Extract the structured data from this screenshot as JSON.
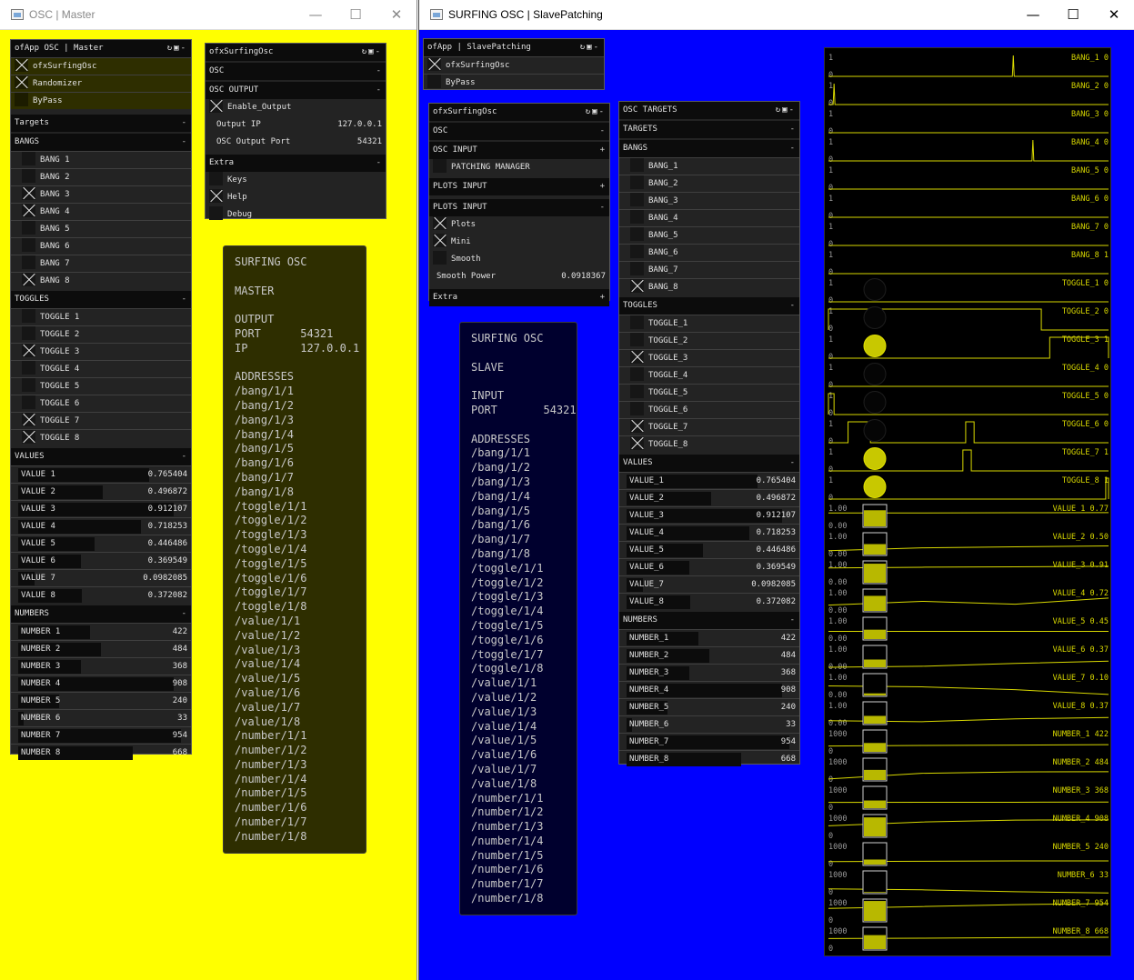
{
  "master": {
    "title": "OSC | Master",
    "bg": "#ffff00",
    "gui": {
      "title": "ofApp OSC | Master",
      "toggles": [
        {
          "label": "ofxSurfingOsc",
          "on": true
        },
        {
          "label": "Randomizer",
          "on": true
        },
        {
          "label": "ByPass",
          "on": false
        }
      ],
      "targets_label": "Targets",
      "bangs_label": "BANGS",
      "bangs": [
        {
          "label": "BANG 1",
          "on": false
        },
        {
          "label": "BANG 2",
          "on": false
        },
        {
          "label": "BANG 3",
          "on": true
        },
        {
          "label": "BANG 4",
          "on": true
        },
        {
          "label": "BANG 5",
          "on": false
        },
        {
          "label": "BANG 6",
          "on": false
        },
        {
          "label": "BANG 7",
          "on": false
        },
        {
          "label": "BANG 8",
          "on": true
        }
      ],
      "toggles_label": "TOGGLES",
      "toggle_items": [
        {
          "label": "TOGGLE 1",
          "on": false
        },
        {
          "label": "TOGGLE 2",
          "on": false
        },
        {
          "label": "TOGGLE 3",
          "on": true
        },
        {
          "label": "TOGGLE 4",
          "on": false
        },
        {
          "label": "TOGGLE 5",
          "on": false
        },
        {
          "label": "TOGGLE 6",
          "on": false
        },
        {
          "label": "TOGGLE 7",
          "on": true
        },
        {
          "label": "TOGGLE 8",
          "on": true
        }
      ],
      "values_label": "VALUES",
      "values": [
        {
          "label": "VALUE 1",
          "value": "0.765404",
          "fill": 0.765404
        },
        {
          "label": "VALUE 2",
          "value": "0.496872",
          "fill": 0.496872
        },
        {
          "label": "VALUE 3",
          "value": "0.912107",
          "fill": 0.912107
        },
        {
          "label": "VALUE 4",
          "value": "0.718253",
          "fill": 0.718253
        },
        {
          "label": "VALUE 5",
          "value": "0.446486",
          "fill": 0.446486
        },
        {
          "label": "VALUE 6",
          "value": "0.369549",
          "fill": 0.369549
        },
        {
          "label": "VALUE 7",
          "value": "0.0982085",
          "fill": 0.0982085
        },
        {
          "label": "VALUE 8",
          "value": "0.372082",
          "fill": 0.372082
        }
      ],
      "numbers_label": "NUMBERS",
      "numbers": [
        {
          "label": "NUMBER 1",
          "value": "422",
          "fill": 0.422
        },
        {
          "label": "NUMBER 2",
          "value": "484",
          "fill": 0.484
        },
        {
          "label": "NUMBER 3",
          "value": "368",
          "fill": 0.368
        },
        {
          "label": "NUMBER 4",
          "value": "908",
          "fill": 0.908
        },
        {
          "label": "NUMBER 5",
          "value": "240",
          "fill": 0.24
        },
        {
          "label": "NUMBER 6",
          "value": "33",
          "fill": 0.033
        },
        {
          "label": "NUMBER 7",
          "value": "954",
          "fill": 0.954
        },
        {
          "label": "NUMBER 8",
          "value": "668",
          "fill": 0.668
        }
      ]
    },
    "osc_gui": {
      "title": "ofxSurfingOsc",
      "osc_label": "OSC",
      "osc_output_label": "OSC OUTPUT",
      "enable_output": "Enable_Output",
      "output_ip_label": "Output IP",
      "output_ip": "127.0.0.1",
      "output_port_label": "OSC Output Port",
      "output_port": "54321",
      "extra_label": "Extra",
      "keys": "Keys",
      "help": "Help",
      "debug": "Debug"
    },
    "info": "SURFING OSC\n\nMASTER\n\nOUTPUT\nPORT      54321\nIP        127.0.0.1\n\nADDRESSES\n/bang/1/1\n/bang/1/2\n/bang/1/3\n/bang/1/4\n/bang/1/5\n/bang/1/6\n/bang/1/7\n/bang/1/8\n/toggle/1/1\n/toggle/1/2\n/toggle/1/3\n/toggle/1/4\n/toggle/1/5\n/toggle/1/6\n/toggle/1/7\n/toggle/1/8\n/value/1/1\n/value/1/2\n/value/1/3\n/value/1/4\n/value/1/5\n/value/1/6\n/value/1/7\n/value/1/8\n/number/1/1\n/number/1/2\n/number/1/3\n/number/1/4\n/number/1/5\n/number/1/6\n/number/1/7\n/number/1/8"
  },
  "slave": {
    "title": "SURFING OSC | SlavePatching",
    "bg": "#0000ff",
    "gui": {
      "title": "ofApp | SlavePatching",
      "toggles": [
        {
          "label": "ofxSurfingOsc",
          "on": true
        },
        {
          "label": "ByPass",
          "on": false
        }
      ]
    },
    "osc_gui": {
      "title": "ofxSurfingOsc",
      "osc_label": "OSC",
      "osc_input_label": "OSC INPUT",
      "patching_manager": "PATCHING MANAGER",
      "plots_input_collapsed": "PLOTS INPUT",
      "plots_input_label": "PLOTS INPUT",
      "plots": "Plots",
      "mini": "Mini",
      "smooth": "Smooth",
      "smooth_power_label": "Smooth Power",
      "smooth_power": "0.0918367",
      "extra_label": "Extra"
    },
    "targets_gui": {
      "title": "OSC TARGETS",
      "targets_label": "TARGETS",
      "bangs_label": "BANGS",
      "bangs": [
        {
          "label": "BANG_1",
          "on": false
        },
        {
          "label": "BANG_2",
          "on": false
        },
        {
          "label": "BANG_3",
          "on": false
        },
        {
          "label": "BANG_4",
          "on": false
        },
        {
          "label": "BANG_5",
          "on": false
        },
        {
          "label": "BANG_6",
          "on": false
        },
        {
          "label": "BANG_7",
          "on": false
        },
        {
          "label": "BANG_8",
          "on": true
        }
      ],
      "toggles_label": "TOGGLES",
      "toggle_items": [
        {
          "label": "TOGGLE_1",
          "on": false
        },
        {
          "label": "TOGGLE_2",
          "on": false
        },
        {
          "label": "TOGGLE_3",
          "on": true
        },
        {
          "label": "TOGGLE_4",
          "on": false
        },
        {
          "label": "TOGGLE_5",
          "on": false
        },
        {
          "label": "TOGGLE_6",
          "on": false
        },
        {
          "label": "TOGGLE_7",
          "on": true
        },
        {
          "label": "TOGGLE_8",
          "on": true
        }
      ],
      "values_label": "VALUES",
      "values": [
        {
          "label": "VALUE_1",
          "value": "0.765404",
          "fill": 0.765404
        },
        {
          "label": "VALUE_2",
          "value": "0.496872",
          "fill": 0.496872
        },
        {
          "label": "VALUE_3",
          "value": "0.912107",
          "fill": 0.912107
        },
        {
          "label": "VALUE_4",
          "value": "0.718253",
          "fill": 0.718253
        },
        {
          "label": "VALUE_5",
          "value": "0.446486",
          "fill": 0.446486
        },
        {
          "label": "VALUE_6",
          "value": "0.369549",
          "fill": 0.369549
        },
        {
          "label": "VALUE_7",
          "value": "0.0982085",
          "fill": 0.0982085
        },
        {
          "label": "VALUE_8",
          "value": "0.372082",
          "fill": 0.372082
        }
      ],
      "numbers_label": "NUMBERS",
      "numbers": [
        {
          "label": "NUMBER_1",
          "value": "422",
          "fill": 0.422
        },
        {
          "label": "NUMBER_2",
          "value": "484",
          "fill": 0.484
        },
        {
          "label": "NUMBER_3",
          "value": "368",
          "fill": 0.368
        },
        {
          "label": "NUMBER_4",
          "value": "908",
          "fill": 0.908
        },
        {
          "label": "NUMBER_5",
          "value": "240",
          "fill": 0.24
        },
        {
          "label": "NUMBER_6",
          "value": "33",
          "fill": 0.033
        },
        {
          "label": "NUMBER_7",
          "value": "954",
          "fill": 0.954
        },
        {
          "label": "NUMBER_8",
          "value": "668",
          "fill": 0.668
        }
      ]
    },
    "info": "SURFING OSC\n\nSLAVE\n\nINPUT\nPORT       54321\n\nADDRESSES\n/bang/1/1\n/bang/1/2\n/bang/1/3\n/bang/1/4\n/bang/1/5\n/bang/1/6\n/bang/1/7\n/bang/1/8\n/toggle/1/1\n/toggle/1/2\n/toggle/1/3\n/toggle/1/4\n/toggle/1/5\n/toggle/1/6\n/toggle/1/7\n/toggle/1/8\n/value/1/1\n/value/1/2\n/value/1/3\n/value/1/4\n/value/1/5\n/value/1/6\n/value/1/7\n/value/1/8\n/number/1/1\n/number/1/2\n/number/1/3\n/number/1/4\n/number/1/5\n/number/1/6\n/number/1/7\n/number/1/8",
    "plots": [
      {
        "label": "BANG_1 0",
        "max": "1",
        "min": "0",
        "kind": "bang",
        "spikes": [
          0.66
        ]
      },
      {
        "label": "BANG_2 0",
        "max": "1",
        "min": "0",
        "kind": "bang",
        "spikes": [
          0.02
        ]
      },
      {
        "label": "BANG_3 0",
        "max": "1",
        "min": "0",
        "kind": "bang",
        "spikes": []
      },
      {
        "label": "BANG_4 0",
        "max": "1",
        "min": "0",
        "kind": "bang",
        "spikes": [
          0.73
        ]
      },
      {
        "label": "BANG_5 0",
        "max": "1",
        "min": "0",
        "kind": "bang",
        "spikes": []
      },
      {
        "label": "BANG_6 0",
        "max": "1",
        "min": "0",
        "kind": "bang",
        "spikes": []
      },
      {
        "label": "BANG_7 0",
        "max": "1",
        "min": "0",
        "kind": "bang",
        "spikes": []
      },
      {
        "label": "BANG_8 1",
        "max": "1",
        "min": "0",
        "kind": "bang",
        "spikes": []
      },
      {
        "label": "TOGGLE_1 0",
        "max": "1",
        "min": "0",
        "kind": "toggle",
        "state": 0,
        "segments": []
      },
      {
        "label": "TOGGLE_2 0",
        "max": "1",
        "min": "0",
        "kind": "toggle",
        "state": 0,
        "segments": [
          [
            0,
            0.76
          ]
        ]
      },
      {
        "label": "TOGGLE_3 1",
        "max": "1",
        "min": "0",
        "kind": "toggle",
        "state": 1,
        "segments": [
          [
            0.79,
            1
          ]
        ]
      },
      {
        "label": "TOGGLE_4 0",
        "max": "1",
        "min": "0",
        "kind": "toggle",
        "state": 0,
        "segments": []
      },
      {
        "label": "TOGGLE_5 0",
        "max": "1",
        "min": "0",
        "kind": "toggle",
        "state": 0,
        "segments": [
          [
            0,
            0.02
          ]
        ]
      },
      {
        "label": "TOGGLE_6 0",
        "max": "1",
        "min": "0",
        "kind": "toggle",
        "state": 0,
        "segments": [
          [
            0.07,
            0.15
          ],
          [
            0.49,
            0.52
          ]
        ]
      },
      {
        "label": "TOGGLE_7 1",
        "max": "1",
        "min": "0",
        "kind": "toggle",
        "state": 1,
        "segments": [
          [
            0.48,
            0.51
          ]
        ]
      },
      {
        "label": "TOGGLE_8 1",
        "max": "1",
        "min": "0",
        "kind": "toggle",
        "state": 1,
        "segments": [
          [
            0.99,
            1
          ]
        ]
      },
      {
        "label": "VALUE_1 0.77",
        "max": "1.00",
        "min": "0.00",
        "kind": "value",
        "level": 0.77,
        "trace": [
          0.75,
          0.75,
          0.76,
          0.77
        ]
      },
      {
        "label": "VALUE_2 0.50",
        "max": "1.00",
        "min": "0.00",
        "kind": "value",
        "level": 0.5,
        "trace": [
          0.25,
          0.4,
          0.45,
          0.5
        ]
      },
      {
        "label": "VALUE_3 0.91",
        "max": "1.00",
        "min": "0.00",
        "kind": "value",
        "level": 0.91,
        "trace": [
          0.82,
          0.86,
          0.88,
          0.91
        ]
      },
      {
        "label": "VALUE_4 0.72",
        "max": "1.00",
        "min": "0.00",
        "kind": "value",
        "level": 0.72,
        "trace": [
          0.35,
          0.55,
          0.4,
          0.72
        ]
      },
      {
        "label": "VALUE_5 0.45",
        "max": "1.00",
        "min": "0.00",
        "kind": "value",
        "level": 0.45,
        "trace": [
          0.45,
          0.45,
          0.45,
          0.45
        ]
      },
      {
        "label": "VALUE_6 0.37",
        "max": "1.00",
        "min": "0.00",
        "kind": "value",
        "level": 0.37,
        "trace": [
          0.05,
          0.1,
          0.25,
          0.37
        ]
      },
      {
        "label": "VALUE_7 0.10",
        "max": "1.00",
        "min": "0.00",
        "kind": "value",
        "level": 0.1,
        "trace": [
          0.55,
          0.5,
          0.35,
          0.1
        ]
      },
      {
        "label": "VALUE_8 0.37",
        "max": "1.00",
        "min": "0.00",
        "kind": "value",
        "level": 0.37,
        "trace": [
          0.2,
          0.15,
          0.3,
          0.37
        ]
      },
      {
        "label": "NUMBER_1 422",
        "max": "1000",
        "min": "0",
        "kind": "value",
        "level": 0.422,
        "trace": [
          0.35,
          0.38,
          0.4,
          0.422
        ]
      },
      {
        "label": "NUMBER_2 484",
        "max": "1000",
        "min": "0",
        "kind": "value",
        "level": 0.484,
        "trace": [
          0.1,
          0.4,
          0.47,
          0.484
        ]
      },
      {
        "label": "NUMBER_3 368",
        "max": "1000",
        "min": "0",
        "kind": "value",
        "level": 0.368,
        "trace": [
          0.35,
          0.36,
          0.36,
          0.368
        ]
      },
      {
        "label": "NUMBER_4 908",
        "max": "1000",
        "min": "0",
        "kind": "value",
        "level": 0.908,
        "trace": [
          0.6,
          0.8,
          0.9,
          0.908
        ]
      },
      {
        "label": "NUMBER_5 240",
        "max": "1000",
        "min": "0",
        "kind": "value",
        "level": 0.24,
        "trace": [
          0.2,
          0.22,
          0.24,
          0.24
        ]
      },
      {
        "label": "NUMBER_6 33",
        "max": "1000",
        "min": "0",
        "kind": "value",
        "level": 0.033,
        "trace": [
          0.25,
          0.2,
          0.1,
          0.033
        ]
      },
      {
        "label": "NUMBER_7 954",
        "max": "1000",
        "min": "0",
        "kind": "value",
        "level": 0.954,
        "trace": [
          0.7,
          0.8,
          0.9,
          0.954
        ]
      },
      {
        "label": "NUMBER_8 668",
        "max": "1000",
        "min": "0",
        "kind": "value",
        "level": 0.668,
        "trace": [
          0.6,
          0.62,
          0.65,
          0.668
        ]
      }
    ]
  },
  "icons": {
    "refresh": "refresh-icon",
    "save": "save-icon",
    "collapse": "collapse-icon",
    "minimize": "minimize-icon",
    "maximize": "maximize-icon",
    "close": "close-icon"
  },
  "colors": {
    "plot_line": "#d8d800",
    "panel_text": "#c8c8c8",
    "info_master_bg": "#2e2e00",
    "info_slave_bg": "#00002e"
  }
}
